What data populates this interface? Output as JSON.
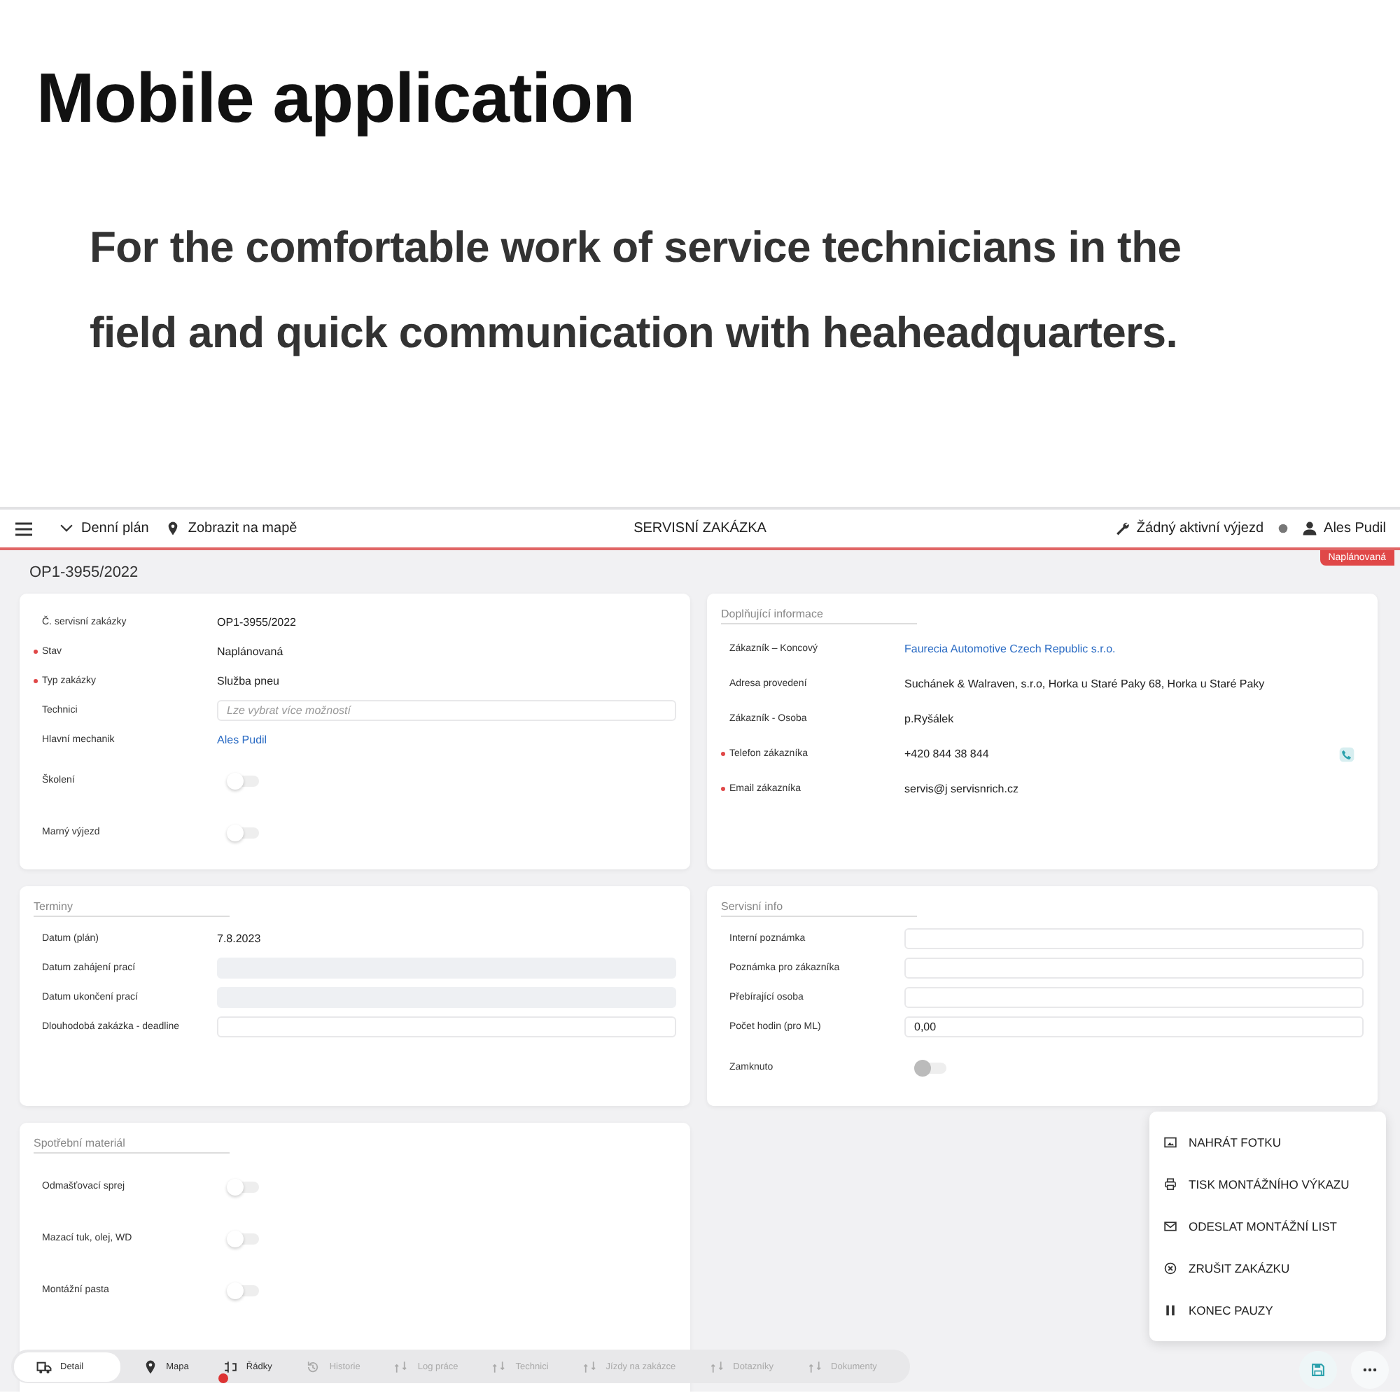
{
  "headline": {
    "title": "Mobile application",
    "subtitle_lines": [
      "For the comfortable work of service technicians in the",
      "field and quick communication with heaheadquarters."
    ]
  },
  "top_bar": {
    "left": [
      {
        "label": "Denní plán"
      },
      {
        "label": "Zobrazit na mapě"
      }
    ],
    "title": "SERVISNÍ ZAKÁZKA",
    "right": [
      {
        "label": "Žádný aktivní výjezd"
      },
      {
        "label": "Ales Pudil"
      }
    ]
  },
  "order_number": "OP1-3955/2022",
  "status_badge": "Naplánovaná",
  "cards": [
    {
      "rows": [
        {
          "label": "Č. servisní zakázky",
          "required": false,
          "kind": "text",
          "value": "OP1-3955/2022"
        },
        {
          "label": "Stav",
          "required": true,
          "kind": "text",
          "value": "Naplánovaná"
        },
        {
          "label": "Typ zakázky",
          "required": true,
          "kind": "text",
          "value": "Služba pneu"
        },
        {
          "label": "Technici",
          "required": false,
          "kind": "input",
          "placeholder": "Lze vybrat více možností"
        },
        {
          "label": "Hlavní mechanik",
          "required": false,
          "kind": "link",
          "value": "Ales Pudil"
        },
        {
          "label": "Školení",
          "required": false,
          "kind": "toggle",
          "checked": false,
          "disabled": false
        },
        {
          "label": "Marný výjezd",
          "required": false,
          "kind": "toggle",
          "checked": false,
          "disabled": false
        }
      ]
    },
    {
      "title": "Doplňující informace",
      "rows": [
        {
          "label": "Zákazník – Koncový",
          "required": false,
          "kind": "link",
          "value": "Faurecia Automotive Czech Republic s.r.o."
        },
        {
          "label": "Adresa provedení",
          "required": false,
          "kind": "text",
          "value": "Suchánek & Walraven, s.r.o, Horka u Staré Paky 68, Horka u Staré Paky"
        },
        {
          "label": "Zákazník - Osoba",
          "required": false,
          "kind": "text",
          "value": "p.Ryšálek"
        },
        {
          "label": "Telefon zákazníka",
          "required": true,
          "kind": "phone",
          "value": "+420  844  38 844"
        },
        {
          "label": "Email zákazníka",
          "required": true,
          "kind": "text",
          "value": "servis@j servisnrich.cz"
        }
      ]
    },
    {
      "title": "Terminy",
      "rows": [
        {
          "label": "Datum (plán)",
          "required": false,
          "kind": "text",
          "value": "7.8.2023"
        },
        {
          "label": "Datum zahájení prací",
          "required": false,
          "kind": "readonly"
        },
        {
          "label": "Datum ukončení prací",
          "required": false,
          "kind": "readonly"
        },
        {
          "label": "Dlouhodobá zakázka - deadline",
          "required": false,
          "kind": "input"
        }
      ]
    },
    {
      "title": "Servisní info",
      "rows": [
        {
          "label": "Interní poznámka",
          "required": false,
          "kind": "input"
        },
        {
          "label": "Poznámka pro zákazníka",
          "required": false,
          "kind": "input"
        },
        {
          "label": "Přebírající osoba",
          "required": false,
          "kind": "input"
        },
        {
          "label": "Počet hodin (pro ML)",
          "required": false,
          "kind": "input",
          "value": "0,00"
        },
        {
          "label": "Zamknuto",
          "required": false,
          "kind": "toggle",
          "checked": false,
          "disabled": true
        }
      ]
    },
    {
      "title": "Spotřební materiál",
      "rows": [
        {
          "label": "Odmašťovací sprej",
          "required": false,
          "kind": "toggle",
          "checked": false,
          "disabled": false
        },
        {
          "label": "Mazací tuk, olej, WD",
          "required": false,
          "kind": "toggle",
          "checked": false,
          "disabled": false
        },
        {
          "label": "Montážní pasta",
          "required": false,
          "kind": "toggle",
          "checked": false,
          "disabled": false
        }
      ]
    }
  ],
  "bottom_nav": [
    {
      "label": "Detail",
      "selected": true,
      "disabled": false,
      "badge": false
    },
    {
      "label": "Mapa",
      "selected": false,
      "disabled": false,
      "badge": false
    },
    {
      "label": "Řádky",
      "selected": false,
      "disabled": false,
      "badge": true
    },
    {
      "label": "Historie",
      "selected": false,
      "disabled": true,
      "badge": false
    },
    {
      "label": "Log práce",
      "selected": false,
      "disabled": true,
      "badge": false
    },
    {
      "label": "Technici",
      "selected": false,
      "disabled": true,
      "badge": false
    },
    {
      "label": "Jízdy na zakázce",
      "selected": false,
      "disabled": true,
      "badge": false
    },
    {
      "label": "Dotazníky",
      "selected": false,
      "disabled": true,
      "badge": false
    },
    {
      "label": "Dokumenty",
      "selected": false,
      "disabled": true,
      "badge": false
    }
  ],
  "menu": [
    {
      "label": "NAHRÁT FOTKU"
    },
    {
      "label": "TISK MONTÁŽNÍHO VÝKAZU"
    },
    {
      "label": "ODESLAT MONTÁŽNÍ LIST"
    },
    {
      "label": "ZRUŠIT ZAKÁZKU"
    },
    {
      "label": "KONEC PAUZY"
    }
  ]
}
